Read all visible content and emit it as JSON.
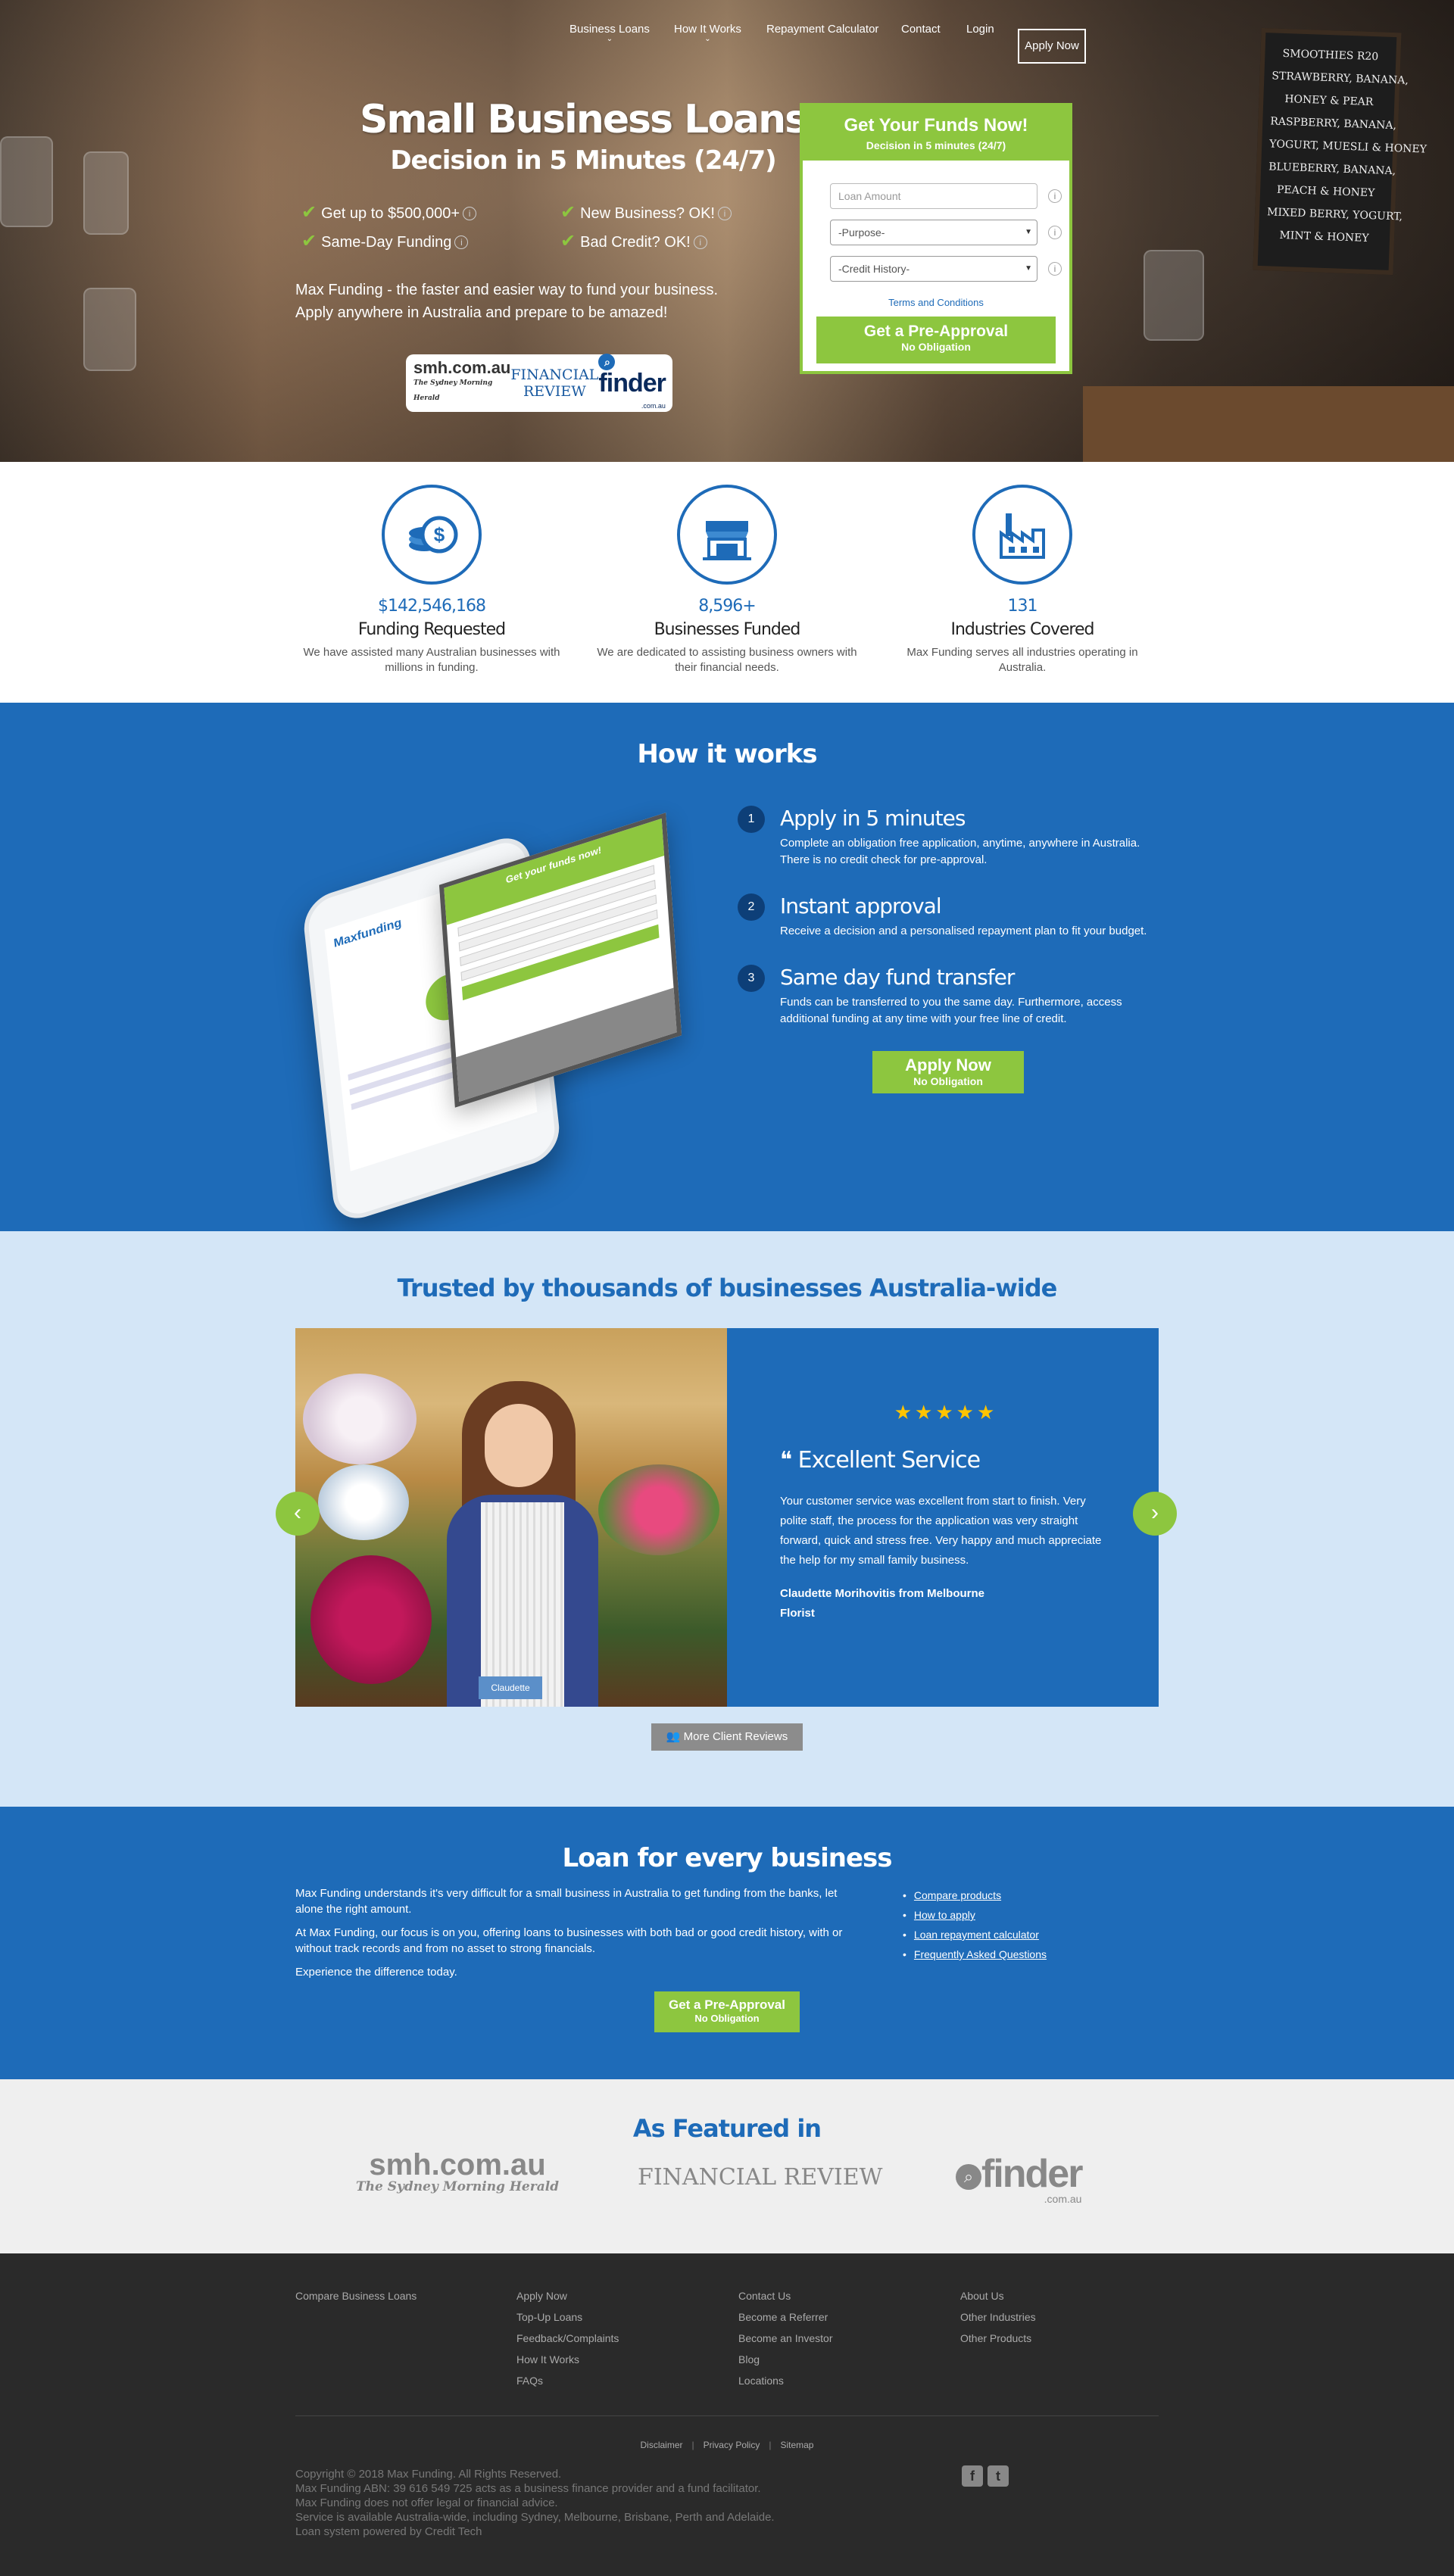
{
  "nav": {
    "items": [
      {
        "label": "Business Loans",
        "dropdown": true
      },
      {
        "label": "How It Works",
        "dropdown": true
      },
      {
        "label": "Repayment Calculator",
        "dropdown": false
      },
      {
        "label": "Contact",
        "dropdown": false
      },
      {
        "label": "Login",
        "dropdown": false
      }
    ],
    "apply_label": "Apply Now"
  },
  "hero": {
    "title": "Small Business Loans",
    "subtitle": "Decision in 5 Minutes (24/7)",
    "features": [
      "Get up to $500,000+",
      "New Business? OK!",
      "Same-Day Funding",
      "Bad Credit? OK!"
    ],
    "description": "Max Funding - the faster and easier way to fund your business. Apply anywhere in Australia and prepare to be amazed!",
    "press": {
      "smh": "smh.com.au",
      "smh_sub": "The Sydney Morning Herald",
      "afr": "FINANCIAL REVIEW",
      "finder": "finder",
      "finder_sub": ".com.au"
    },
    "board_lines": [
      "SMOOTHIES R20",
      "STRAWBERRY, BANANA,",
      "HONEY & PEAR",
      "RASPBERRY, BANANA,",
      "YOGURT, MUESLI & HONEY",
      "BLUEBERRY, BANANA,",
      "PEACH & HONEY",
      "MIXED BERRY, YOGURT,",
      "MINT & HONEY"
    ]
  },
  "form": {
    "title": "Get Your Funds Now!",
    "subtitle": "Decision in 5 minutes (24/7)",
    "amount_placeholder": "Loan Amount",
    "purpose": "-Purpose-",
    "credit": "-Credit History-",
    "terms": "Terms and Conditions",
    "button": "Get a Pre-Approval",
    "button_sub": "No Obligation"
  },
  "stats": [
    {
      "icon": "coins-dollar-icon",
      "number": "$142,546,168",
      "label": "Funding Requested",
      "text": "We have assisted many Australian businesses with millions in funding."
    },
    {
      "icon": "storefront-icon",
      "number": "8,596+",
      "label": "Businesses Funded",
      "text": "We are dedicated to assisting business owners with their financial needs."
    },
    {
      "icon": "factory-icon",
      "number": "131",
      "label": "Industries Covered",
      "text": "Max Funding serves all industries operating in Australia."
    }
  ],
  "how": {
    "title": "How it works",
    "steps": [
      {
        "n": "1",
        "title": "Apply in 5 minutes",
        "text": "Complete an obligation free application, anytime, anywhere in Australia. There is no credit check for pre-approval."
      },
      {
        "n": "2",
        "title": "Instant approval",
        "text": "Receive a decision and a personalised repayment plan to fit your budget."
      },
      {
        "n": "3",
        "title": "Same day fund transfer",
        "text": "Funds can be transferred to you the same day. Furthermore, access additional funding at any time with your free line of credit."
      }
    ],
    "button": "Apply Now",
    "button_sub": "No Obligation",
    "tablet_title": "Get your funds now!",
    "phone_logo": "Maxfunding"
  },
  "trust": {
    "title": "Trusted by thousands of businesses Australia-wide",
    "stars": "★★★★★",
    "rating": 5,
    "quote_title": "❝ Excellent Service",
    "quote": "Your customer service was excellent from start to finish. Very polite staff, the process for the application was very straight forward, quick and stress free. Very happy and much appreciate the help for my small family business.",
    "author": "Claudette Morihovitis from Melbourne",
    "role": "Florist",
    "caption": "Claudette",
    "more": "More Client Reviews"
  },
  "loan": {
    "title": "Loan for every business",
    "p1": "Max Funding understands it's very difficult for a small business in Australia to get funding from the banks, let alone the right amount.",
    "p2": "At Max Funding, our focus is on you, offering loans to businesses with both bad or good credit history, with or without track records and from no asset to strong financials.",
    "p3": "Experience the difference today.",
    "links": [
      "Compare products",
      "How to apply",
      "Loan repayment calculator",
      "Frequently Asked Questions"
    ],
    "button": "Get a Pre-Approval",
    "button_sub": "No Obligation"
  },
  "featured": {
    "title": "As Featured in"
  },
  "footer": {
    "col1": [
      "Compare Business Loans"
    ],
    "col2": [
      "Apply Now",
      "Top-Up Loans",
      "Feedback/Complaints",
      "How It Works",
      "FAQs"
    ],
    "col3": [
      "Contact Us",
      "Become a Referrer",
      "Become an Investor",
      "Blog",
      "Locations"
    ],
    "col4": [
      "About Us",
      "Other Industries",
      "Other Products"
    ],
    "legal": [
      "Disclaimer",
      "Privacy Policy",
      "Sitemap"
    ],
    "copy": [
      "Copyright © 2018 Max Funding. All Rights Reserved.",
      "Max Funding ABN: 39 616 549 725 acts as a business finance provider and a fund facilitator.",
      "Max Funding does not offer legal or financial advice.",
      "Service is available Australia-wide, including Sydney, Melbourne, Brisbane, Perth and Adelaide.",
      "Loan system powered by Credit Tech"
    ]
  },
  "colors": {
    "primary": "#1e6bb8",
    "accent": "#8dc63f",
    "footer": "#2a2a2a",
    "star": "#ffc400"
  }
}
